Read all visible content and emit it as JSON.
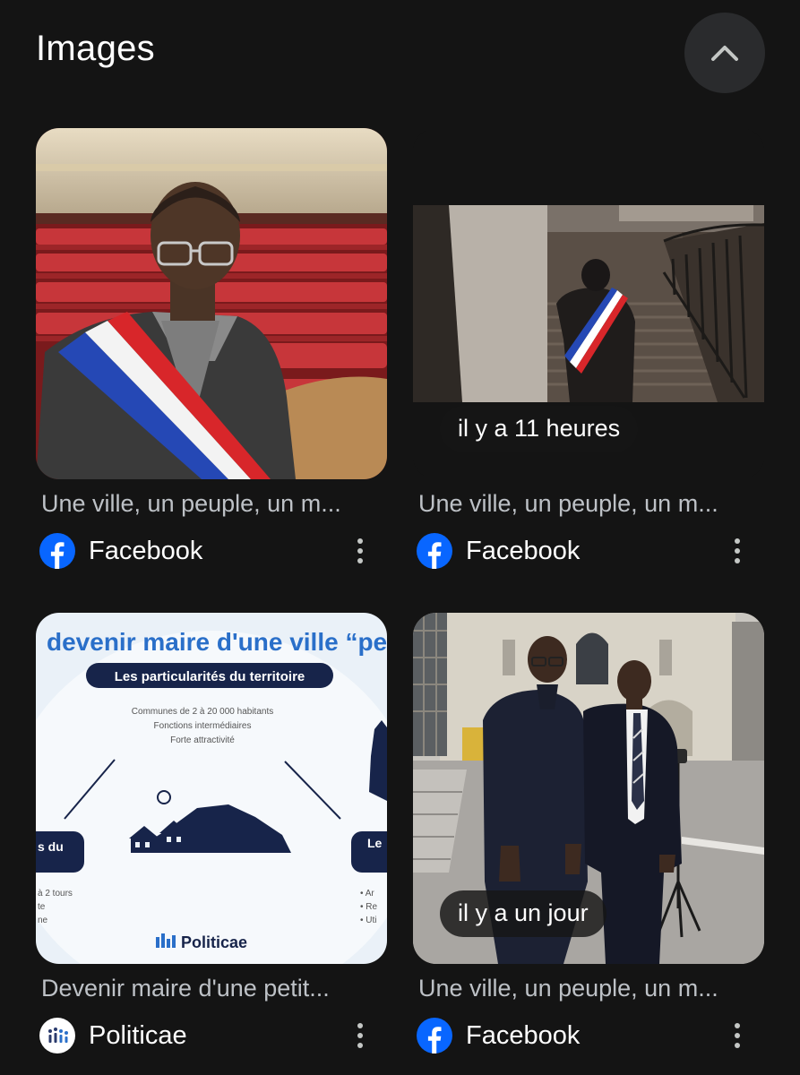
{
  "section": {
    "title": "Images"
  },
  "results": [
    {
      "caption": "Une ville, un peuple, un m...",
      "source": "Facebook",
      "time": ""
    },
    {
      "caption": "Une ville, un peuple, un m...",
      "source": "Facebook",
      "time": "il y a 11 heures"
    },
    {
      "caption": "Devenir maire d'une petit...",
      "source": "Politicae",
      "time": "",
      "infographic": {
        "heading": "devenir maire d'une ville “peu",
        "subheading": "Les particularités du territoire",
        "lines": [
          "Communes de 2 à 20 000 habitants",
          "Fonctions intermédiaires",
          "Forte attractivité"
        ],
        "left_label": "s du",
        "right_label": "Le",
        "left_notes": [
          "à 2 tours",
          "te",
          "ne"
        ],
        "right_notes": [
          "• Ar",
          "• Re",
          "• Uti"
        ],
        "brand": "Politicae"
      }
    },
    {
      "caption": "Une ville, un peuple, un m...",
      "source": "Facebook",
      "time": "il y a un jour"
    }
  ],
  "colors": {
    "background": "#141414",
    "facebook_blue": "#0866ff",
    "chip_bg": "#161616"
  }
}
